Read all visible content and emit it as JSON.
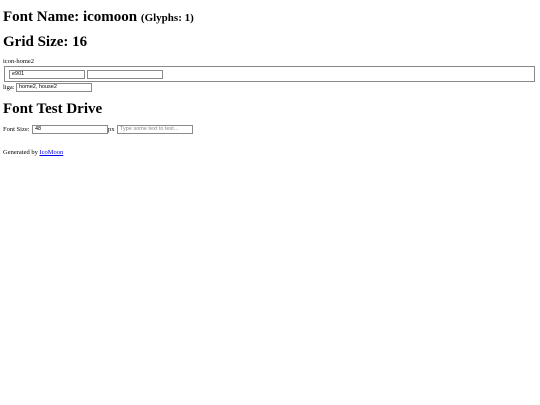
{
  "header": {
    "font_name_label": "Font Name:",
    "font_name": "icomoon",
    "glyphs_count": "(Glyphs: 1)",
    "grid_size_label": "Grid Size:",
    "grid_size": "16"
  },
  "glyph": {
    "name": "icon-home2",
    "code_value": "e901",
    "char_value": "",
    "liga_label": "liga:",
    "liga_value": "home2, house2"
  },
  "test_drive": {
    "title": "Font Test Drive",
    "font_size_label": "Font Size:",
    "font_size_value": "48",
    "unit": "px",
    "test_placeholder": "Type some text to test..."
  },
  "footer": {
    "generated_by": "Generated by",
    "link_text": "IcoMoon"
  }
}
